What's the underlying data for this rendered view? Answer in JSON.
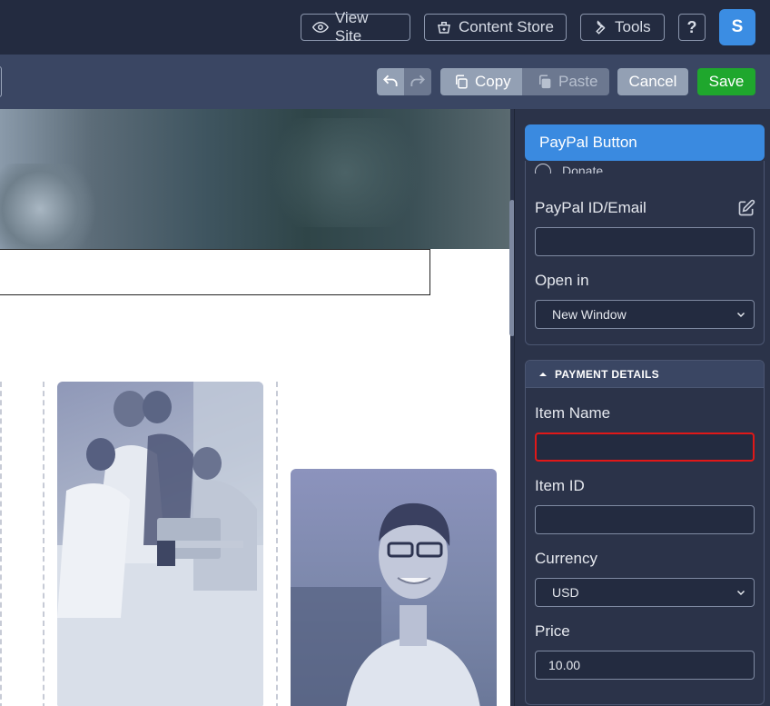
{
  "topbar": {
    "view_site": "View Site",
    "content_store": "Content Store",
    "tools": "Tools",
    "help": "?",
    "avatar_initial": "S"
  },
  "toolbar": {
    "copy": "Copy",
    "paste": "Paste",
    "cancel": "Cancel",
    "save": "Save"
  },
  "panel": {
    "title": "PayPal Button",
    "radio_partial_label": "Donate",
    "paypal_id_label": "PayPal ID/Email",
    "paypal_id_value": "",
    "open_in_label": "Open in",
    "open_in_value": "New Window",
    "payment_section": "PAYMENT DETAILS",
    "item_name_label": "Item Name",
    "item_name_value": "",
    "item_id_label": "Item ID",
    "item_id_value": "",
    "currency_label": "Currency",
    "currency_value": "USD",
    "price_label": "Price",
    "price_value": "10.00"
  },
  "colors": {
    "accent": "#3a8ae0",
    "save": "#1fa72d",
    "active_border": "#e01818"
  }
}
